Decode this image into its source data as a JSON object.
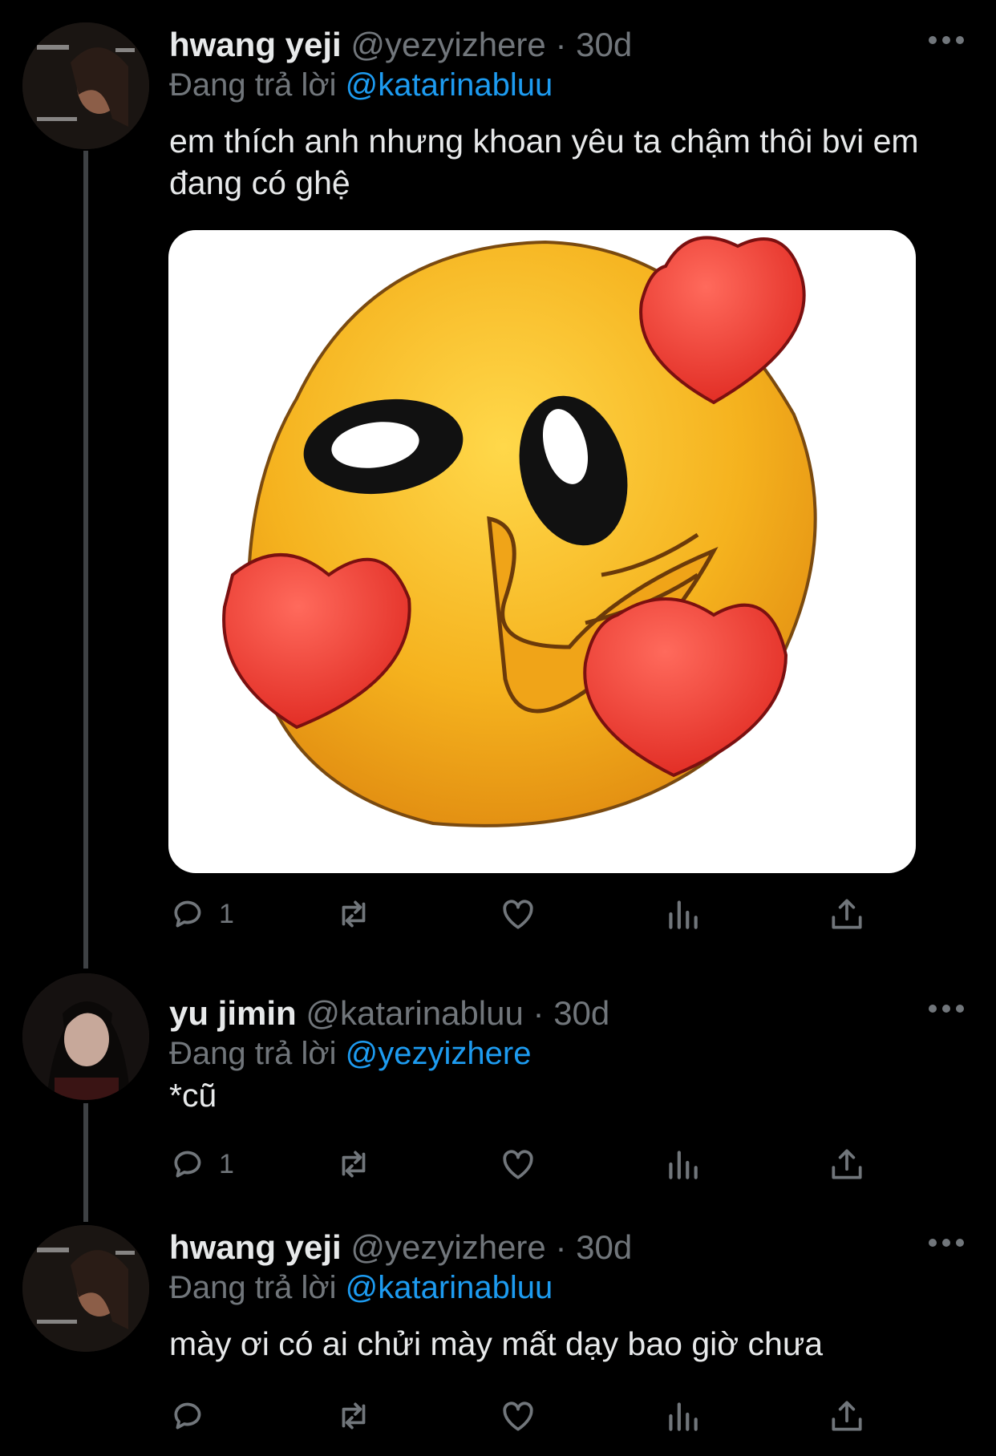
{
  "tweets": [
    {
      "name": "hwang yeji",
      "handle": "@yezyizhere",
      "sep": "·",
      "time": "30d",
      "reply_prefix": "Đang trả lời",
      "reply_to": "@katarinabluu",
      "text": "em thích anh nhưng khoan yêu ta chậm thôi bvi em đang có ghệ",
      "reply_count": "1"
    },
    {
      "name": "yu jimin",
      "handle": "@katarinabluu",
      "sep": "·",
      "time": "30d",
      "reply_prefix": "Đang trả lời",
      "reply_to": "@yezyizhere",
      "text": "*cũ",
      "reply_count": "1"
    },
    {
      "name": "hwang yeji",
      "handle": "@yezyizhere",
      "sep": "·",
      "time": "30d",
      "reply_prefix": "Đang trả lời",
      "reply_to": "@katarinabluu",
      "text": "mày ơi có ai chửi mày mất dạy bao giờ chưa",
      "reply_count": ""
    }
  ],
  "colors": {
    "background": "#000000",
    "text": "#e7e9ea",
    "secondary": "#71767b",
    "link": "#1d9bf0",
    "thread_line": "#3e4144"
  },
  "icons": [
    "reply-icon",
    "retweet-icon",
    "like-icon",
    "analytics-icon",
    "share-icon",
    "more-icon"
  ]
}
